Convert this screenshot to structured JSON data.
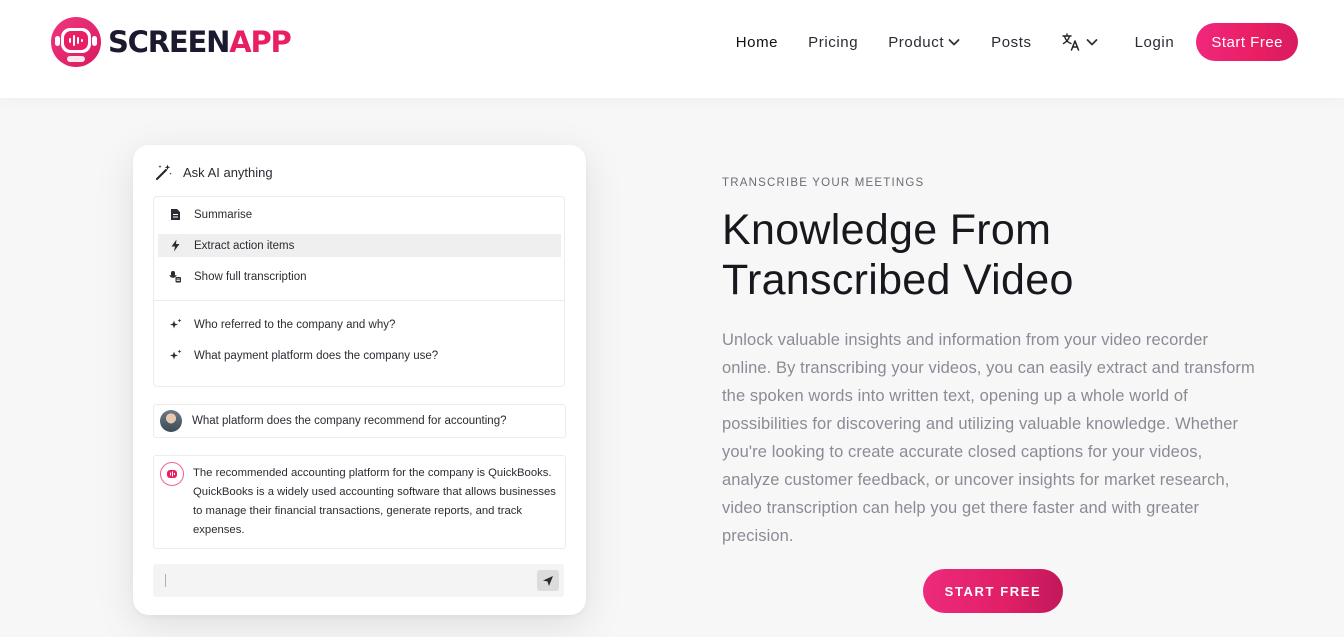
{
  "brand": {
    "name_part1": "SCREEN",
    "name_part2": "APP",
    "color_dark": "#1b1a2e",
    "color_accent": "#e91e63"
  },
  "nav": {
    "items": [
      {
        "label": "Home",
        "active": true
      },
      {
        "label": "Pricing"
      },
      {
        "label": "Product",
        "icon": "chevron-down-icon"
      },
      {
        "label": "Posts"
      }
    ],
    "language_icon": "translate-icon",
    "login_label": "Login",
    "start_free_label": "Start Free"
  },
  "ai_card": {
    "ask_label": "Ask AI anything",
    "ask_icon": "magic-wand-icon",
    "menu_actions": [
      {
        "label": "Summarise",
        "icon": "document-icon"
      },
      {
        "label": "Extract action items",
        "icon": "lightning-icon",
        "highlighted": true
      },
      {
        "label": "Show full transcription",
        "icon": "transcription-icon"
      }
    ],
    "suggestions": [
      {
        "label": "Who referred to the company and why?",
        "icon": "sparkle-icon"
      },
      {
        "label": "What payment platform does the company use?",
        "icon": "sparkle-icon"
      }
    ],
    "user_question": "What platform does the company recommend for accounting?",
    "ai_answer": "The recommended accounting platform for the company is QuickBooks. QuickBooks is a widely used accounting software that allows businesses to manage their financial transactions, generate reports, and track expenses.",
    "input_value": "",
    "send_icon": "send-icon"
  },
  "hero": {
    "eyebrow": "TRANSCRIBE YOUR MEETINGS",
    "title_line1": "Knowledge From",
    "title_line2": "Transcribed Video",
    "body": "Unlock valuable insights and information from your video recorder online. By transcribing your videos, you can easily extract and transform the spoken words into written text, opening up a whole world of possibilities for discovering and utilizing valuable knowledge. Whether you're looking to create accurate closed captions for your videos, analyze customer feedback, or uncover insights for market research, video transcription can help you get there faster and with greater precision.",
    "cta_label": "START FREE"
  }
}
